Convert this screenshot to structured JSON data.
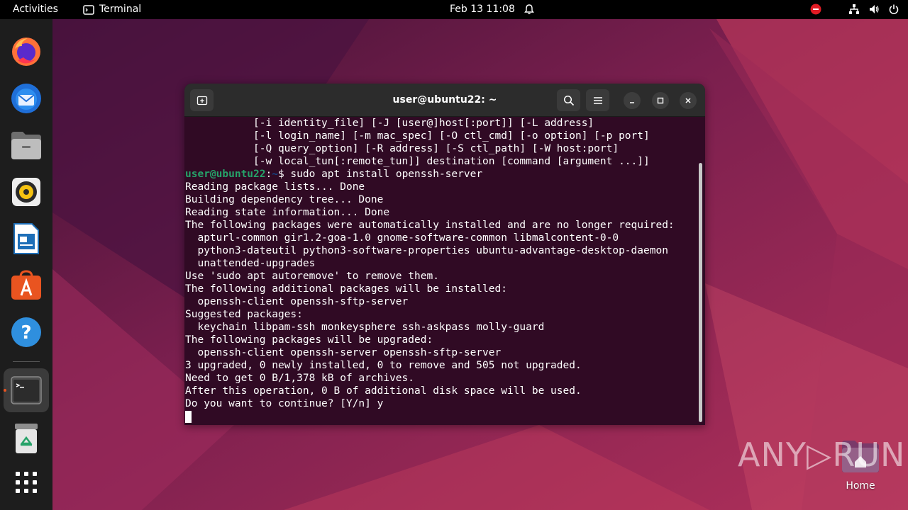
{
  "topbar": {
    "activities": "Activities",
    "app_name": "Terminal",
    "datetime": "Feb 13  11:08"
  },
  "dock": {
    "items": [
      "firefox-icon",
      "thunderbird-icon",
      "files-icon",
      "rhythmbox-icon",
      "libreoffice-writer-icon",
      "app-center-icon",
      "help-icon",
      "terminal-icon",
      "trash-icon",
      "show-apps-icon"
    ]
  },
  "terminal": {
    "title": "user@ubuntu22: ~",
    "lines": [
      "           [-i identity_file] [-J [user@]host[:port]] [-L address]",
      "           [-l login_name] [-m mac_spec] [-O ctl_cmd] [-o option] [-p port]",
      "           [-Q query_option] [-R address] [-S ctl_path] [-W host:port]",
      "           [-w local_tun[:remote_tun]] destination [command [argument ...]]"
    ],
    "prompt_user": "user@ubuntu22",
    "prompt_sep": ":",
    "prompt_path": "~",
    "prompt_command": "$ sudo apt install openssh-server",
    "output": [
      "Reading package lists... Done",
      "Building dependency tree... Done",
      "Reading state information... Done",
      "The following packages were automatically installed and are no longer required:",
      "  apturl-common gir1.2-goa-1.0 gnome-software-common libmalcontent-0-0",
      "  python3-dateutil python3-software-properties ubuntu-advantage-desktop-daemon",
      "  unattended-upgrades",
      "Use 'sudo apt autoremove' to remove them.",
      "The following additional packages will be installed:",
      "  openssh-client openssh-sftp-server",
      "Suggested packages:",
      "  keychain libpam-ssh monkeysphere ssh-askpass molly-guard",
      "The following packages will be upgraded:",
      "  openssh-client openssh-server openssh-sftp-server",
      "3 upgraded, 0 newly installed, 0 to remove and 505 not upgraded.",
      "Need to get 0 B/1,378 kB of archives.",
      "After this operation, 0 B of additional disk space will be used.",
      "Do you want to continue? [Y/n] y"
    ]
  },
  "watermark": {
    "text": "ANY▷RUN"
  },
  "desktop": {
    "home_label": "Home"
  },
  "colors": {
    "terminal_bg": "#300a24",
    "prompt_user": "#26a269",
    "prompt_path": "#12488b",
    "accent": "#e95420"
  }
}
